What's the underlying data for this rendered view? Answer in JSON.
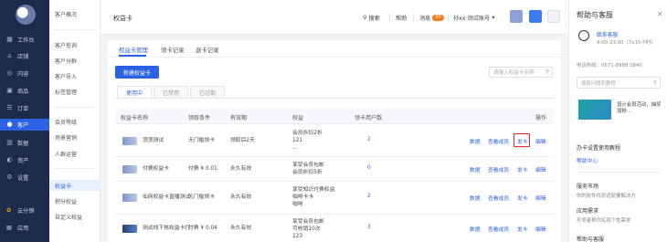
{
  "nav": {
    "items": [
      {
        "label": "工作台",
        "icon": "dashboard-icon"
      },
      {
        "label": "店铺",
        "icon": "store-icon"
      },
      {
        "label": "内容",
        "icon": "content-icon"
      },
      {
        "label": "商品",
        "icon": "product-icon"
      },
      {
        "label": "订单",
        "icon": "order-icon"
      },
      {
        "label": "客户",
        "icon": "customer-icon"
      },
      {
        "label": "数据",
        "icon": "data-icon"
      },
      {
        "label": "资产",
        "icon": "asset-icon"
      },
      {
        "label": "设置",
        "icon": "settings-icon"
      }
    ],
    "bottom": [
      {
        "label": "云分销",
        "icon": "cloud-icon"
      },
      {
        "label": "应用",
        "icon": "apps-icon"
      }
    ]
  },
  "subnav": {
    "items": [
      "客户概况",
      "客户查询",
      "客户分群",
      "客户导入",
      "标签管理",
      "会员等级",
      "场景营销",
      "人群运营",
      "权益卡",
      "积分权益",
      "自定义权益"
    ]
  },
  "topbar": {
    "title": "权益卡",
    "search": "搜索",
    "help": "帮助",
    "messages": "消息",
    "message_count": "99",
    "account": "孙xx·测试账号"
  },
  "main": {
    "tabs": [
      "权益卡管理",
      "领卡记录",
      "退卡记录"
    ],
    "new_button": "新建权益卡",
    "search_placeholder": "请输入权益卡名称",
    "status_tabs": [
      "使用中",
      "已禁用",
      "已过期"
    ],
    "columns": [
      "权益卡名称",
      "领取条件",
      "有效期",
      "权益",
      "领卡用户数",
      "操作"
    ],
    "rows": [
      {
        "name": "顶顶测试",
        "condition": "无门槛领卡",
        "validity": "领取后2天",
        "benefits": "会员折扣2折\n121\n...",
        "users": "2",
        "actions": [
          "数据",
          "查看成员",
          "发卡",
          "编辑"
        ]
      },
      {
        "name": "付费权益卡",
        "condition": "付费 ¥ 0.01",
        "validity": "永久有效",
        "benefits": "享受会员包邮\n会员折扣5折",
        "users": "0",
        "actions": [
          "数据",
          "查看成员",
          "发卡",
          "编辑"
        ]
      },
      {
        "name": "仙网权益卡直播测试",
        "condition": "无门槛领卡",
        "validity": "永久有效",
        "benefits": "享受知识付费权益\n咖啡卡卡\n咖啡",
        "users": "2",
        "actions": [
          "数据",
          "查看成员",
          "发卡",
          "编辑"
        ]
      },
      {
        "name": "测试线下核权益卡打",
        "condition": "付费 ¥ 0.04",
        "validity": "永久有效",
        "benefits": "享受会员包邮\n可核销10次\n123",
        "users": "3",
        "actions": [
          "数据",
          "查看成员",
          "发卡",
          "编辑"
        ]
      }
    ]
  },
  "right_panel": {
    "title": "帮助与客服",
    "contact": "联系客服",
    "hours": "9:00-23:00（7x15小时）",
    "phone_label": "电话热线：",
    "phone": "0571-8988 0840",
    "search_placeholder": "搜索问题和教程",
    "banner_text": "设计会员活动，抽奖加粉...",
    "tutorial_title": "办卡设置使用教程",
    "help_center": "帮助中心",
    "service_market": "服务市场",
    "service_market_desc": "你的软件找到适配要解决方",
    "app_demand": "应用需求",
    "app_demand_desc": "开发者帮你实现个性需求",
    "more": "帮助与客服"
  },
  "colors": {
    "nav_bg": "#1e2a4a",
    "accent": "#2b62e3",
    "highlight": "#e22222"
  }
}
